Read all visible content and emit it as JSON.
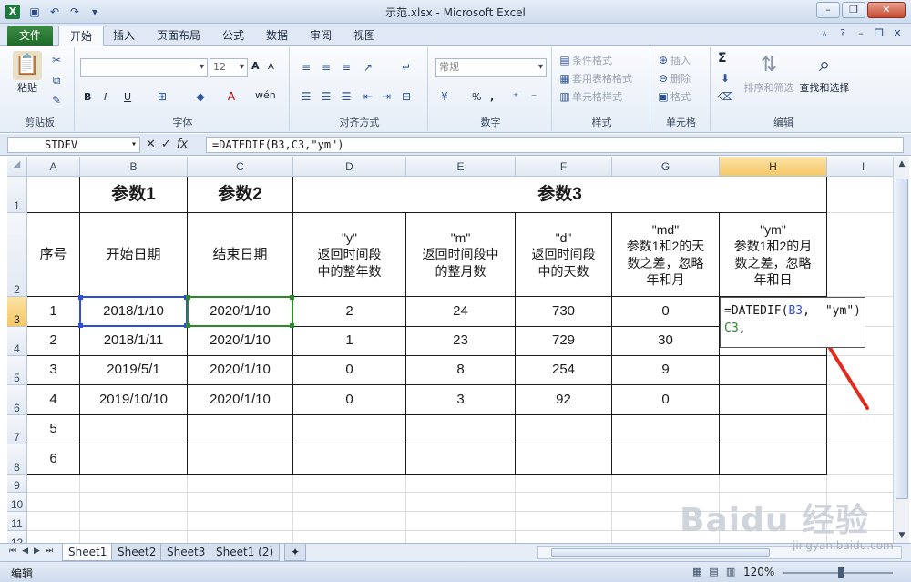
{
  "window": {
    "title": "示范.xlsx - Microsoft Excel",
    "app_icon": "X"
  },
  "ribbon_tabs": [
    "文件",
    "开始",
    "插入",
    "页面布局",
    "公式",
    "数据",
    "审阅",
    "视图"
  ],
  "ribbon": {
    "clipboard": {
      "label": "剪贴板",
      "paste": "粘贴"
    },
    "font": {
      "label": "字体",
      "font_name": "",
      "font_size": "12",
      "bold": "B",
      "italic": "I",
      "underline": "U",
      "grow": "A",
      "shrink": "A",
      "wen": "wén"
    },
    "alignment": {
      "label": "对齐方式"
    },
    "number": {
      "label": "数字",
      "format": "常规",
      "percent": "%",
      "comma": ","
    },
    "styles": {
      "label": "样式",
      "conditional": "条件格式",
      "table": "套用表格格式",
      "cell_styles": "单元格样式"
    },
    "cells": {
      "label": "单元格",
      "insert": "插入",
      "delete": "删除",
      "format": "格式"
    },
    "editing": {
      "label": "编辑",
      "sort_filter": "排序和筛选",
      "find_select": "查找和选择",
      "sum": "Σ"
    }
  },
  "formula_bar": {
    "name_box": "STDEV",
    "fx": "fx",
    "formula": "=DATEDIF(B3,C3,\"ym\")"
  },
  "columns": [
    "A",
    "B",
    "C",
    "D",
    "E",
    "F",
    "G",
    "H",
    "I"
  ],
  "rows": [
    "1",
    "2",
    "3",
    "4",
    "5",
    "6",
    "7",
    "8",
    "9",
    "10",
    "11",
    "12"
  ],
  "table": {
    "h1_param1": "参数1",
    "h1_param2": "参数2",
    "h1_param3": "参数3",
    "a2": "序号",
    "b2": "开始日期",
    "c2": "结束日期",
    "d2": "\"y\"\n返回时间段\n中的整年数",
    "e2": "\"m\"\n返回时间段中\n的整月数",
    "f2": "\"d\"\n返回时间段\n中的天数",
    "g2": "\"md\"\n参数1和2的天\n数之差，忽略\n年和月",
    "h2": "\"ym\"\n参数1和2的月\n数之差，忽略\n年和日",
    "data": [
      [
        "1",
        "2018/1/10",
        "2020/1/10",
        "2",
        "24",
        "730",
        "0",
        "=DATEDIF(B3, C3,\n\"ym\")"
      ],
      [
        "2",
        "2018/1/11",
        "2020/1/10",
        "1",
        "23",
        "729",
        "30",
        ""
      ],
      [
        "3",
        "2019/5/1",
        "2020/1/10",
        "0",
        "8",
        "254",
        "9",
        ""
      ],
      [
        "4",
        "2019/10/10",
        "2020/1/10",
        "0",
        "3",
        "92",
        "0",
        ""
      ],
      [
        "5",
        "",
        "",
        "",
        "",
        "",
        "",
        ""
      ],
      [
        "6",
        "",
        "",
        "",
        "",
        "",
        "",
        ""
      ]
    ]
  },
  "formula_edit": {
    "prefix": "=DATEDIF(",
    "ref1": "B3",
    "sep1": ", ",
    "ref2": "C3",
    "sep2": ",",
    "tail": "\"ym\")"
  },
  "sheet_tabs": [
    "Sheet1",
    "Sheet2",
    "Sheet3",
    "Sheet1 (2)"
  ],
  "status": {
    "mode": "编辑",
    "zoom": "120%"
  },
  "watermark": {
    "brand": "Baidu 经验",
    "url": "jingyan.baidu.com"
  },
  "colors": {
    "ref1": "#2f4fd8",
    "ref2": "#2c8a2c",
    "arrow": "#e02b1d",
    "selected_header": "#f5c766"
  }
}
